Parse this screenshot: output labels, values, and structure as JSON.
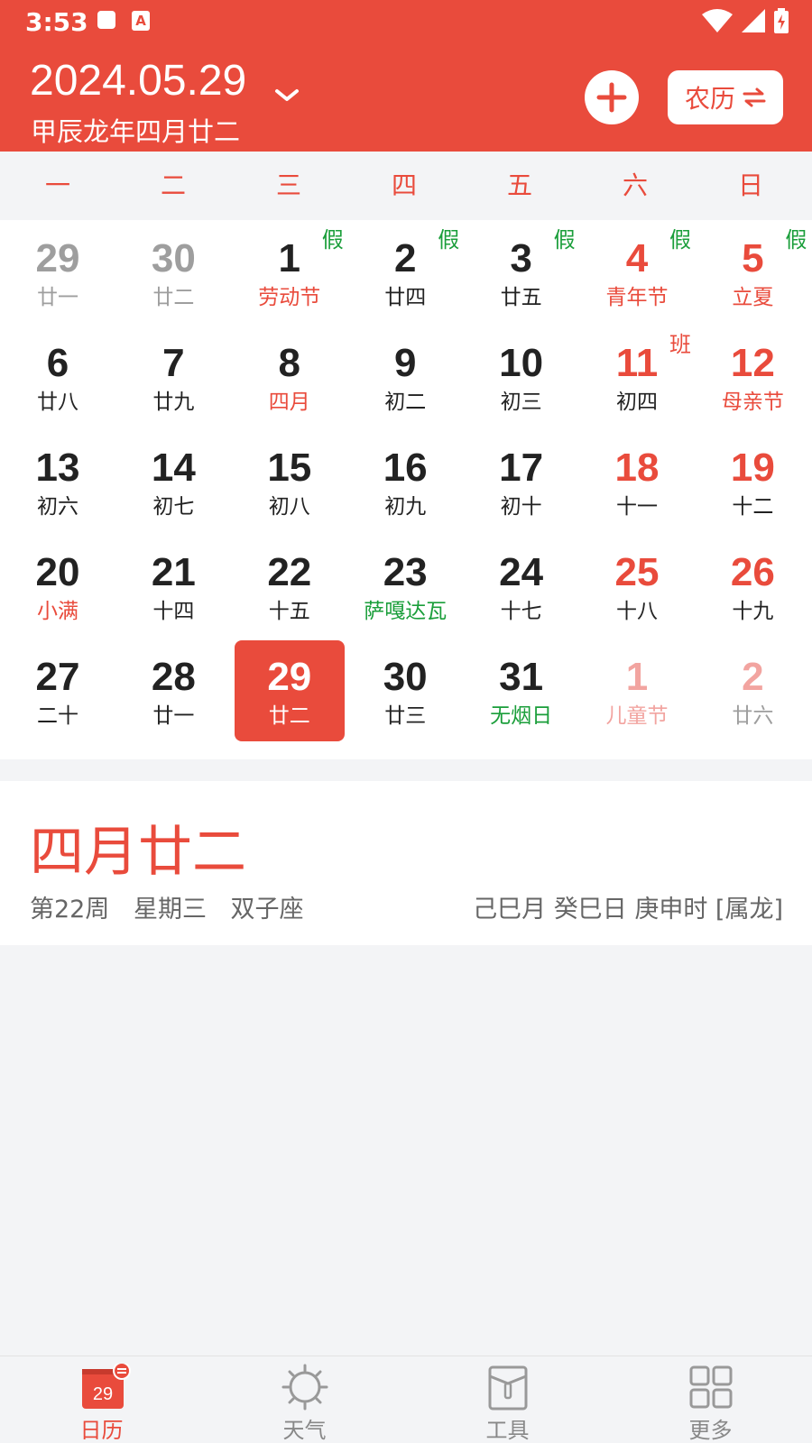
{
  "status_bar": {
    "time": "3:53",
    "a_icon_text": "A"
  },
  "header": {
    "date": "2024.05.29",
    "lunar_date": "甲辰龙年四月廿二",
    "lunar_toggle_label": "农历"
  },
  "weekdays": [
    "一",
    "二",
    "三",
    "四",
    "五",
    "六",
    "日"
  ],
  "calendar": [
    {
      "row": 0,
      "col": 0,
      "day": "29",
      "sub": "廿一",
      "day_color": "#9e9e9e",
      "sub_color": "#9e9e9e"
    },
    {
      "row": 0,
      "col": 1,
      "day": "30",
      "sub": "廿二",
      "day_color": "#9e9e9e",
      "sub_color": "#9e9e9e"
    },
    {
      "row": 0,
      "col": 2,
      "day": "1",
      "sub": "劳动节",
      "day_color": "#222",
      "sub_color": "#e94b3c",
      "badge": "假",
      "badge_color": "#1a9e3a"
    },
    {
      "row": 0,
      "col": 3,
      "day": "2",
      "sub": "廿四",
      "day_color": "#222",
      "sub_color": "#222",
      "badge": "假",
      "badge_color": "#1a9e3a"
    },
    {
      "row": 0,
      "col": 4,
      "day": "3",
      "sub": "廿五",
      "day_color": "#222",
      "sub_color": "#222",
      "badge": "假",
      "badge_color": "#1a9e3a"
    },
    {
      "row": 0,
      "col": 5,
      "day": "4",
      "sub": "青年节",
      "day_color": "#e94b3c",
      "sub_color": "#e94b3c",
      "badge": "假",
      "badge_color": "#1a9e3a"
    },
    {
      "row": 0,
      "col": 6,
      "day": "5",
      "sub": "立夏",
      "day_color": "#e94b3c",
      "sub_color": "#e94b3c",
      "badge": "假",
      "badge_color": "#1a9e3a"
    },
    {
      "row": 1,
      "col": 0,
      "day": "6",
      "sub": "廿八",
      "day_color": "#222",
      "sub_color": "#222"
    },
    {
      "row": 1,
      "col": 1,
      "day": "7",
      "sub": "廿九",
      "day_color": "#222",
      "sub_color": "#222"
    },
    {
      "row": 1,
      "col": 2,
      "day": "8",
      "sub": "四月",
      "day_color": "#222",
      "sub_color": "#e94b3c"
    },
    {
      "row": 1,
      "col": 3,
      "day": "9",
      "sub": "初二",
      "day_color": "#222",
      "sub_color": "#222"
    },
    {
      "row": 1,
      "col": 4,
      "day": "10",
      "sub": "初三",
      "day_color": "#222",
      "sub_color": "#222"
    },
    {
      "row": 1,
      "col": 5,
      "day": "11",
      "sub": "初四",
      "day_color": "#e94b3c",
      "sub_color": "#222",
      "badge": "班",
      "badge_color": "#e94b3c"
    },
    {
      "row": 1,
      "col": 6,
      "day": "12",
      "sub": "母亲节",
      "day_color": "#e94b3c",
      "sub_color": "#e94b3c"
    },
    {
      "row": 2,
      "col": 0,
      "day": "13",
      "sub": "初六",
      "day_color": "#222",
      "sub_color": "#222"
    },
    {
      "row": 2,
      "col": 1,
      "day": "14",
      "sub": "初七",
      "day_color": "#222",
      "sub_color": "#222"
    },
    {
      "row": 2,
      "col": 2,
      "day": "15",
      "sub": "初八",
      "day_color": "#222",
      "sub_color": "#222"
    },
    {
      "row": 2,
      "col": 3,
      "day": "16",
      "sub": "初九",
      "day_color": "#222",
      "sub_color": "#222"
    },
    {
      "row": 2,
      "col": 4,
      "day": "17",
      "sub": "初十",
      "day_color": "#222",
      "sub_color": "#222"
    },
    {
      "row": 2,
      "col": 5,
      "day": "18",
      "sub": "十一",
      "day_color": "#e94b3c",
      "sub_color": "#222"
    },
    {
      "row": 2,
      "col": 6,
      "day": "19",
      "sub": "十二",
      "day_color": "#e94b3c",
      "sub_color": "#222"
    },
    {
      "row": 3,
      "col": 0,
      "day": "20",
      "sub": "小满",
      "day_color": "#222",
      "sub_color": "#e94b3c"
    },
    {
      "row": 3,
      "col": 1,
      "day": "21",
      "sub": "十四",
      "day_color": "#222",
      "sub_color": "#222"
    },
    {
      "row": 3,
      "col": 2,
      "day": "22",
      "sub": "十五",
      "day_color": "#222",
      "sub_color": "#222"
    },
    {
      "row": 3,
      "col": 3,
      "day": "23",
      "sub": "萨嘎达瓦",
      "day_color": "#222",
      "sub_color": "#1a9e3a"
    },
    {
      "row": 3,
      "col": 4,
      "day": "24",
      "sub": "十七",
      "day_color": "#222",
      "sub_color": "#222"
    },
    {
      "row": 3,
      "col": 5,
      "day": "25",
      "sub": "十八",
      "day_color": "#e94b3c",
      "sub_color": "#222"
    },
    {
      "row": 3,
      "col": 6,
      "day": "26",
      "sub": "十九",
      "day_color": "#e94b3c",
      "sub_color": "#222"
    },
    {
      "row": 4,
      "col": 0,
      "day": "27",
      "sub": "二十",
      "day_color": "#222",
      "sub_color": "#222"
    },
    {
      "row": 4,
      "col": 1,
      "day": "28",
      "sub": "廿一",
      "day_color": "#222",
      "sub_color": "#222"
    },
    {
      "row": 4,
      "col": 2,
      "day": "29",
      "sub": "廿二",
      "day_color": "#ffffff",
      "sub_color": "#ffffff",
      "selected": true
    },
    {
      "row": 4,
      "col": 3,
      "day": "30",
      "sub": "廿三",
      "day_color": "#222",
      "sub_color": "#222"
    },
    {
      "row": 4,
      "col": 4,
      "day": "31",
      "sub": "无烟日",
      "day_color": "#222",
      "sub_color": "#1a9e3a"
    },
    {
      "row": 4,
      "col": 5,
      "day": "1",
      "sub": "儿童节",
      "day_color": "#f2a4a0",
      "sub_color": "#f2a4a0"
    },
    {
      "row": 4,
      "col": 6,
      "day": "2",
      "sub": "廿六",
      "day_color": "#f2a4a0",
      "sub_color": "#9e9e9e"
    }
  ],
  "info": {
    "title": "四月廿二",
    "week": "第22周",
    "weekday": "星期三",
    "zodiac": "双子座",
    "ganzhi": "己巳月 癸巳日 庚申时 [属龙]"
  },
  "bottom_nav": [
    {
      "label": "日历",
      "icon": "calendar-icon",
      "active": true,
      "icon_text": "29"
    },
    {
      "label": "天气",
      "icon": "weather-icon",
      "active": false
    },
    {
      "label": "工具",
      "icon": "tools-icon",
      "active": false
    },
    {
      "label": "更多",
      "icon": "more-icon",
      "active": false
    }
  ]
}
